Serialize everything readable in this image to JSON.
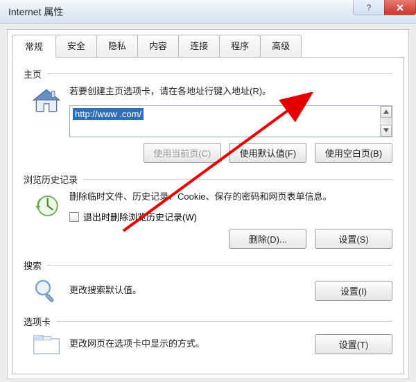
{
  "window": {
    "title": "Internet 属性"
  },
  "tabs": {
    "general": "常规",
    "security": "安全",
    "privacy": "隐私",
    "content": "内容",
    "connections": "连接",
    "programs": "程序",
    "advanced": "高级"
  },
  "home": {
    "title": "主页",
    "desc": "若要创建主页选项卡，请在各地址行键入地址(R)。",
    "url": "http://www         .com/",
    "use_current": "使用当前页(C)",
    "use_default": "使用默认值(F)",
    "use_blank": "使用空白页(B)"
  },
  "history": {
    "title": "浏览历史记录",
    "desc": "删除临时文件、历史记录、Cookie、保存的密码和网页表单信息。",
    "checkbox": "退出时删除浏览历史记录(W)",
    "delete": "删除(D)...",
    "settings": "设置(S)"
  },
  "search": {
    "title": "搜索",
    "desc": "更改搜索默认值。",
    "settings": "设置(I)"
  },
  "tabs_section": {
    "title": "选项卡",
    "desc": "更改网页在选项卡中显示的方式。",
    "settings": "设置(T)"
  }
}
